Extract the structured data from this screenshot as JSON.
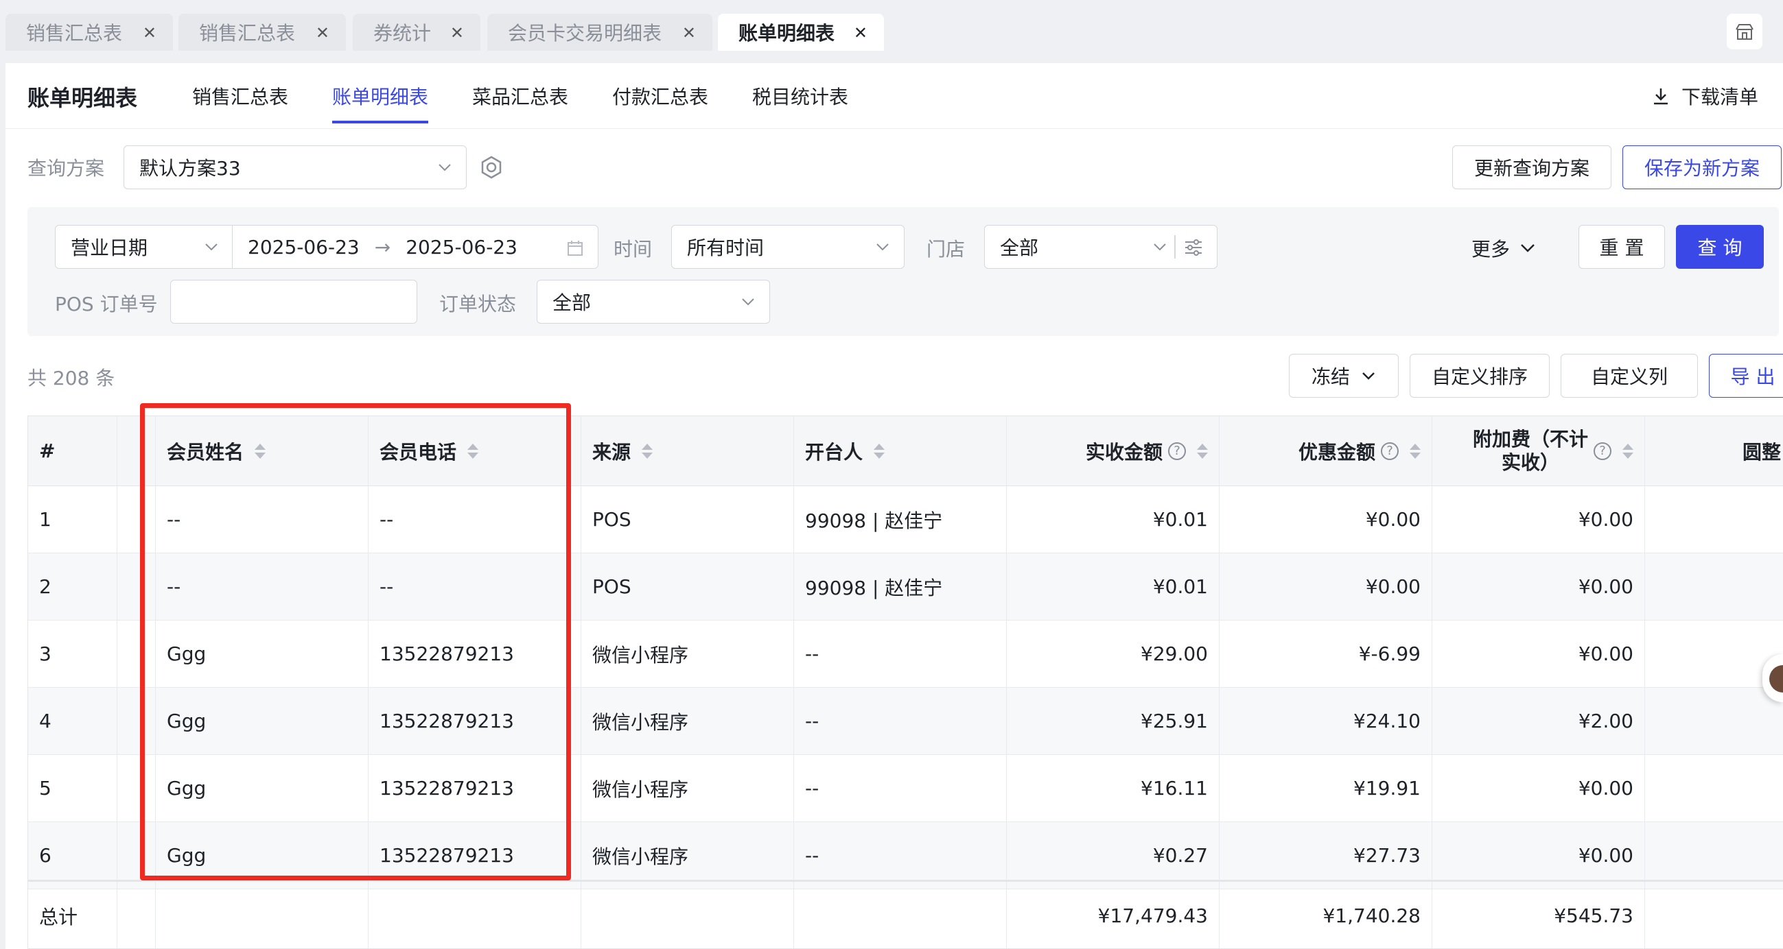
{
  "top_tabs": [
    {
      "label": "销售汇总表"
    },
    {
      "label": "销售汇总表"
    },
    {
      "label": "券统计"
    },
    {
      "label": "会员卡交易明细表"
    },
    {
      "label": "账单明细表"
    }
  ],
  "page_title": "账单明细表",
  "sub_tabs": [
    {
      "label": "销售汇总表"
    },
    {
      "label": "账单明细表"
    },
    {
      "label": "菜品汇总表"
    },
    {
      "label": "付款汇总表"
    },
    {
      "label": "税目统计表"
    }
  ],
  "download_label": "下载清单",
  "query_plan": {
    "label": "查询方案",
    "value": "默认方案33",
    "update_btn": "更新查询方案",
    "save_btn": "保存为新方案"
  },
  "filters": {
    "date_type": "营业日期",
    "date_start": "2025-06-23",
    "date_end": "2025-06-23",
    "time_label": "时间",
    "time_value": "所有时间",
    "store_label": "门店",
    "store_value": "全部",
    "more_label": "更多",
    "reset_label": "重 置",
    "query_label": "查 询",
    "pos_label": "POS 订单号",
    "pos_value": "",
    "status_label": "订单状态",
    "status_value": "全部"
  },
  "summary": {
    "total_text": "共 208 条",
    "freeze": "冻结",
    "custom_sort": "自定义排序",
    "custom_cols": "自定义列",
    "export": "导 出"
  },
  "table": {
    "headers": {
      "idx": "#",
      "name": "会员姓名",
      "phone": "会员电话",
      "source": "来源",
      "opener": "开台人",
      "actual": "实收金额",
      "discount": "优惠金额",
      "surcharge_a": "附加费（不计",
      "surcharge_b": "实收）",
      "last": "圆整"
    },
    "rows": [
      {
        "idx": "1",
        "name": "--",
        "phone": "--",
        "source": "POS",
        "opener": "99098 | 赵佳宁",
        "actual": "¥0.01",
        "discount": "¥0.00",
        "surcharge": "¥0.00"
      },
      {
        "idx": "2",
        "name": "--",
        "phone": "--",
        "source": "POS",
        "opener": "99098 | 赵佳宁",
        "actual": "¥0.01",
        "discount": "¥0.00",
        "surcharge": "¥0.00"
      },
      {
        "idx": "3",
        "name": "Ggg",
        "phone": "13522879213",
        "source": "微信小程序",
        "opener": "--",
        "actual": "¥29.00",
        "discount": "¥-6.99",
        "surcharge": "¥0.00"
      },
      {
        "idx": "4",
        "name": "Ggg",
        "phone": "13522879213",
        "source": "微信小程序",
        "opener": "--",
        "actual": "¥25.91",
        "discount": "¥24.10",
        "surcharge": "¥2.00"
      },
      {
        "idx": "5",
        "name": "Ggg",
        "phone": "13522879213",
        "source": "微信小程序",
        "opener": "--",
        "actual": "¥16.11",
        "discount": "¥19.91",
        "surcharge": "¥0.00"
      },
      {
        "idx": "6",
        "name": "Ggg",
        "phone": "13522879213",
        "source": "微信小程序",
        "opener": "--",
        "actual": "¥0.27",
        "discount": "¥27.73",
        "surcharge": "¥0.00"
      }
    ],
    "total": {
      "label": "总计",
      "actual": "¥17,479.43",
      "discount": "¥1,740.28",
      "surcharge": "¥545.73"
    }
  },
  "colors": {
    "accent": "#3b48e8",
    "highlight_box": "#f02a20"
  }
}
